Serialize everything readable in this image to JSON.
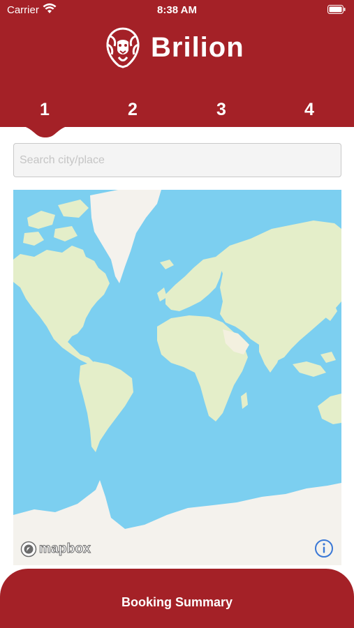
{
  "status_bar": {
    "carrier": "Carrier",
    "time": "8:38 AM",
    "icons": [
      "wifi-icon",
      "battery-icon"
    ]
  },
  "header": {
    "brand_name": "Brilion",
    "logo_icon": "lion-head-icon"
  },
  "steps": {
    "items": [
      "1",
      "2",
      "3",
      "4"
    ],
    "active": "1"
  },
  "search": {
    "placeholder": "Search city/place",
    "value": ""
  },
  "map": {
    "attribution_text": "mapbox",
    "attribution_icon": "mapbox-logo-icon",
    "info_icon": "info-icon"
  },
  "footer": {
    "button_label": "Booking Summary"
  },
  "colors": {
    "brand": "#a42127",
    "ocean": "#7ccff0",
    "land": "#e4eec9",
    "ice": "#f4f2ed",
    "info_blue": "#3a78d6"
  }
}
